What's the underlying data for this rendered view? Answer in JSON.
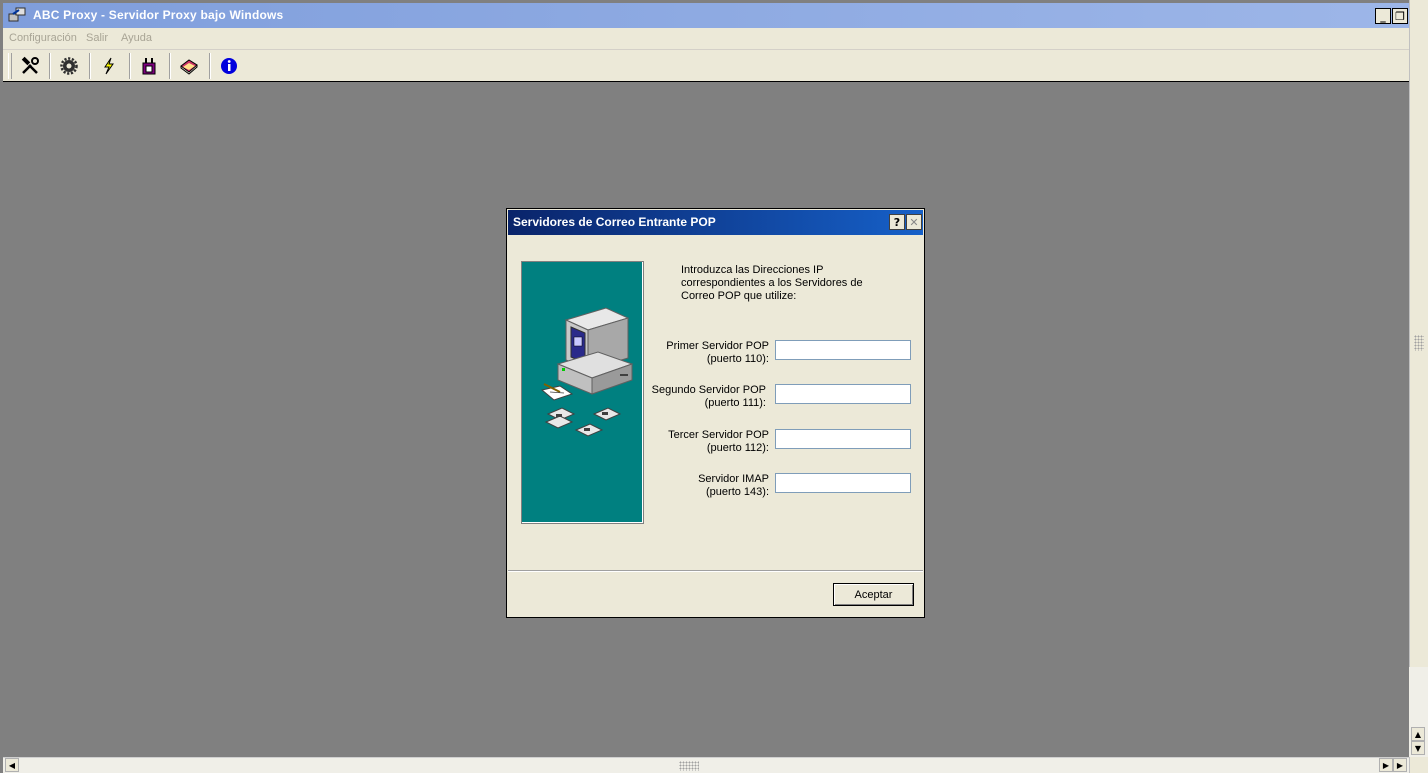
{
  "window": {
    "title": "ABC Proxy - Servidor Proxy bajo Windows",
    "minimize_glyph": "_",
    "restore_glyph": "❐"
  },
  "menu": {
    "items": [
      "Configuración",
      "Salir",
      "Ayuda"
    ]
  },
  "toolbar": {
    "buttons": [
      "tools-icon",
      "gear-icon",
      "lightning-icon",
      "plug-icon",
      "book-icon",
      "info-icon"
    ]
  },
  "dialog": {
    "title": "Servidores de Correo Entrante POP",
    "help_glyph": "?",
    "close_glyph": "✕",
    "intro": "Introduzca las Direcciones IP correspondientes a los Servidores de Correo POP que utilize:",
    "fields": [
      {
        "label_line1": "Primer Servidor POP",
        "label_line2": "(puerto 110):",
        "value": ""
      },
      {
        "label_line1": "Segundo Servidor POP",
        "label_line2": "(puerto 111):",
        "value": ""
      },
      {
        "label_line1": "Tercer Servidor POP",
        "label_line2": "(puerto 112):",
        "value": ""
      },
      {
        "label_line1": "Servidor IMAP",
        "label_line2": "(puerto 143):",
        "value": ""
      }
    ],
    "ok_label": "Aceptar"
  },
  "colors": {
    "titlebar": "#7f9edc",
    "dialog_titlebar": "#0a246a",
    "side_panel": "#008080",
    "workspace": "#808080"
  }
}
